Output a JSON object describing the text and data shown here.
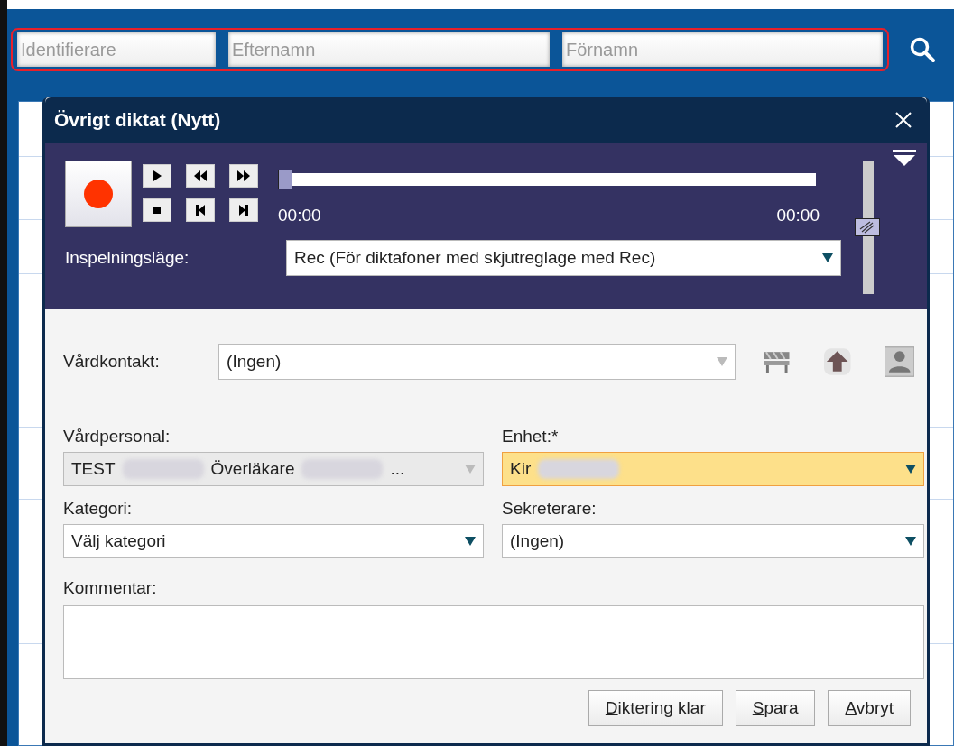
{
  "search": {
    "fields": [
      {
        "placeholder": "Identifierare"
      },
      {
        "placeholder": "Efternamn"
      },
      {
        "placeholder": "Förnamn"
      }
    ]
  },
  "dialog": {
    "title": "Övrigt diktat (Nytt)",
    "player": {
      "transport_buttons": [
        {
          "kind": "play"
        },
        {
          "kind": "rewind"
        },
        {
          "kind": "forward"
        },
        {
          "kind": "stop"
        },
        {
          "kind": "start"
        },
        {
          "kind": "end"
        }
      ],
      "position": {
        "level": 0
      },
      "elapsed": "00:00",
      "duration": "00:00",
      "volume": {
        "level": 0.5
      },
      "recording_mode": {
        "label": "Inspelningsläge:",
        "value": "Rec (För diktafoner med skjutreglage med Rec)"
      }
    },
    "care_contact": {
      "label": "Vårdkontakt:",
      "value": "(Ingen)",
      "disabled": true,
      "tools": [
        {
          "kind": "barrier"
        },
        {
          "kind": "upload"
        },
        {
          "kind": "person"
        }
      ]
    },
    "fields": [
      {
        "label": "Vårdpersonal:",
        "disabled": true,
        "read_only": true,
        "highlighted": false,
        "segments": [
          {
            "kind": "text",
            "text": "TEST"
          },
          {
            "kind": "redacted"
          },
          {
            "kind": "text",
            "text": "Överläkare"
          },
          {
            "kind": "redacted"
          },
          {
            "kind": "text",
            "text": "..."
          }
        ]
      },
      {
        "label": "Enhet:*",
        "disabled": false,
        "read_only": false,
        "highlighted": true,
        "segments": [
          {
            "kind": "text",
            "text": "Kir"
          },
          {
            "kind": "redacted"
          }
        ]
      },
      {
        "label": "Kategori:",
        "disabled": false,
        "read_only": false,
        "highlighted": false,
        "segments": [
          {
            "kind": "text",
            "text": "Välj kategori"
          }
        ]
      },
      {
        "label": "Sekreterare:",
        "disabled": false,
        "read_only": false,
        "highlighted": false,
        "segments": [
          {
            "kind": "text",
            "text": "(Ingen)"
          }
        ]
      }
    ],
    "comment": {
      "label": "Kommentar:"
    },
    "buttons": [
      "Diktering klar",
      "Spara",
      "Avbryt"
    ]
  }
}
